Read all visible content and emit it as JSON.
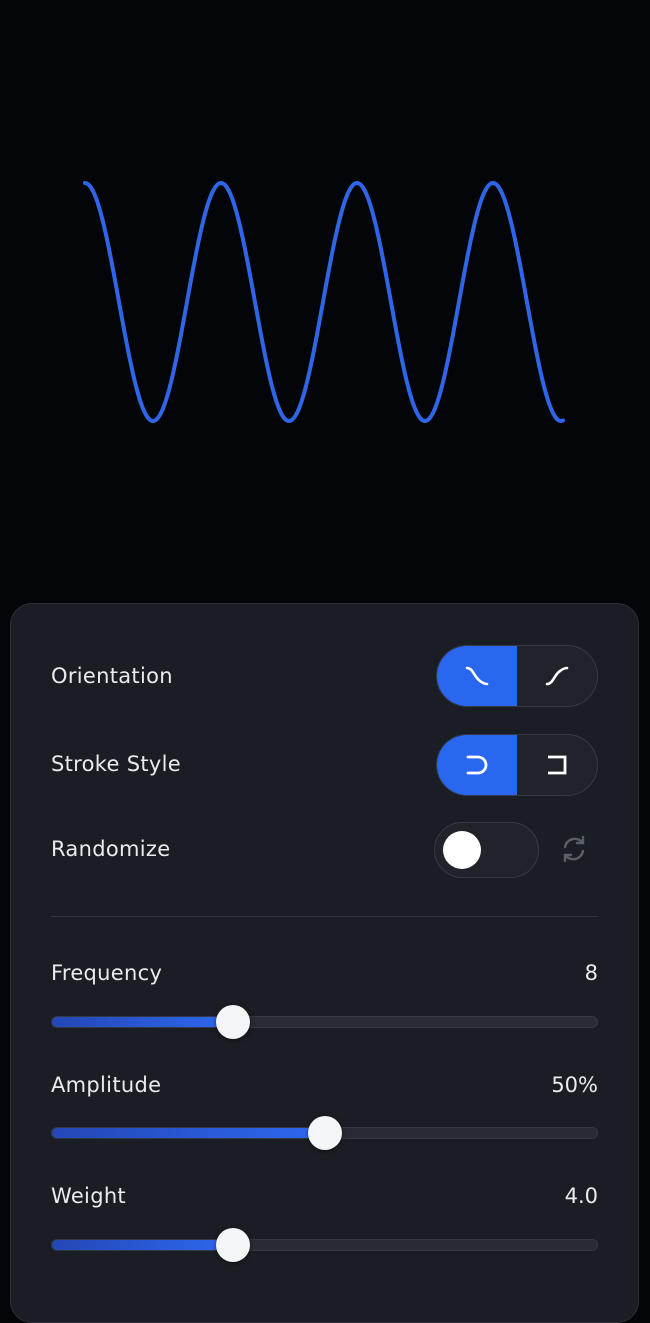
{
  "wave": {
    "color": "#2f66e8",
    "frequency": 8,
    "amplitude_pct": 50,
    "weight": 4.0
  },
  "controls": {
    "orientation": {
      "label": "Orientation",
      "options": [
        "falling-curve-icon",
        "rising-curve-icon"
      ],
      "selected": 0
    },
    "stroke_style": {
      "label": "Stroke Style",
      "options": [
        "round-cap-icon",
        "square-cap-icon"
      ],
      "selected": 0
    },
    "randomize": {
      "label": "Randomize",
      "on": false
    }
  },
  "sliders": [
    {
      "label": "Frequency",
      "value": "8",
      "fraction": 0.333
    },
    {
      "label": "Amplitude",
      "value": "50%",
      "fraction": 0.5
    },
    {
      "label": "Weight",
      "value": "4.0",
      "fraction": 0.333
    }
  ],
  "colors": {
    "accent": "#2a67f0",
    "panel_bg": "#1a1d23",
    "page_bg": "#030509"
  }
}
